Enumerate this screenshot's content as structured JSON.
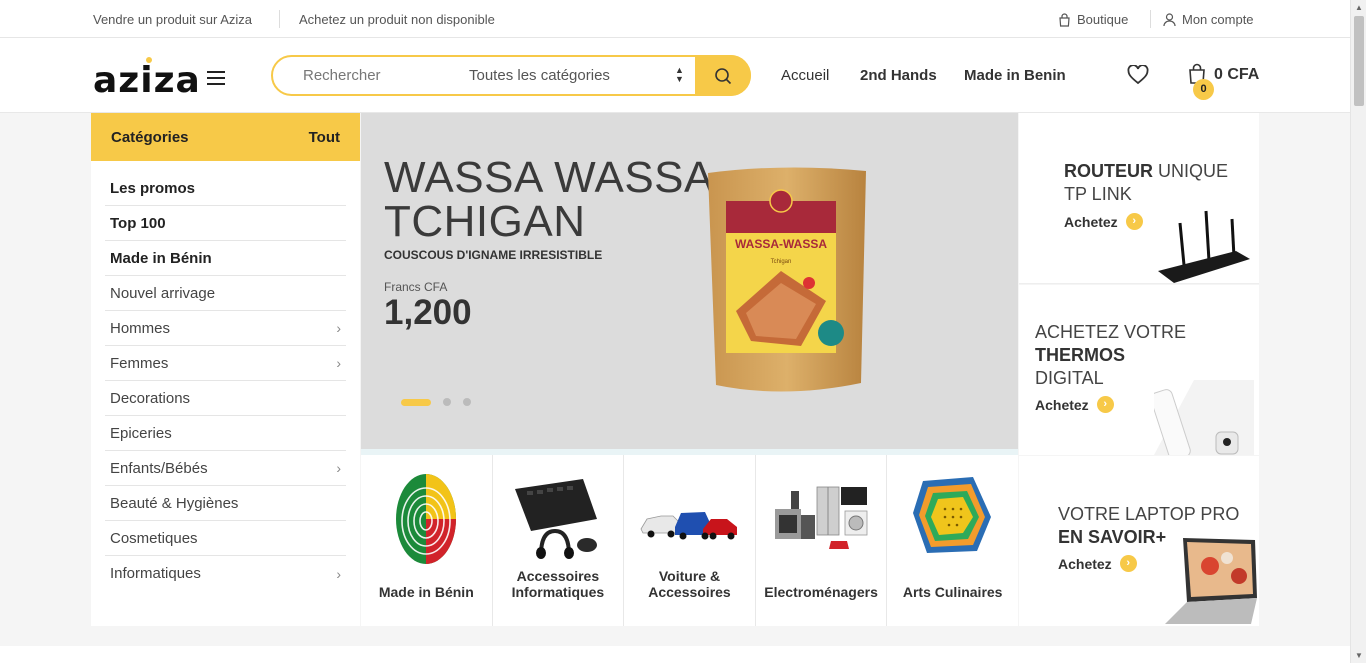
{
  "topbar": {
    "sell_link": "Vendre un produit sur Aziza",
    "request_link": "Achetez un produit non disponible",
    "shop_link": "Boutique",
    "account_link": "Mon compte"
  },
  "header": {
    "logo": "aziza",
    "search_placeholder": "Rechercher",
    "category_select": "Toutes les catégories",
    "nav": [
      "Accueil",
      "2nd Hands",
      "Made in Benin"
    ],
    "cart_count": "0",
    "cart_total": "0 CFA"
  },
  "sidebar": {
    "title": "Catégories",
    "all_link": "Tout",
    "items": [
      {
        "label": "Les promos",
        "bold": true,
        "chevron": false
      },
      {
        "label": "Top 100",
        "bold": true,
        "chevron": false
      },
      {
        "label": "Made in Bénin",
        "bold": true,
        "chevron": false
      },
      {
        "label": "Nouvel arrivage",
        "bold": false,
        "chevron": false
      },
      {
        "label": "Hommes",
        "bold": false,
        "chevron": true
      },
      {
        "label": "Femmes",
        "bold": false,
        "chevron": true
      },
      {
        "label": "Decorations",
        "bold": false,
        "chevron": false
      },
      {
        "label": "Epiceries",
        "bold": false,
        "chevron": false
      },
      {
        "label": "Enfants/Bébés",
        "bold": false,
        "chevron": true
      },
      {
        "label": "Beauté & Hygiènes",
        "bold": false,
        "chevron": false
      },
      {
        "label": "Cosmetiques",
        "bold": false,
        "chevron": false
      },
      {
        "label": "Informatiques",
        "bold": false,
        "chevron": true
      }
    ]
  },
  "banner": {
    "title_line1": "WASSA WASSA",
    "title_line2": "TCHIGAN",
    "subtitle": "COUSCOUS D'IGNAME IRRESISTIBLE",
    "currency": "Francs CFA",
    "price": "1,200",
    "bag_brand": "WASSA-WASSA",
    "bag_sub": "Tchigan",
    "slides": 3,
    "active_slide": 1
  },
  "tiles": [
    {
      "label": "Made in Bénin",
      "icon": "fingerprint-benin-flag"
    },
    {
      "label": "Accessoires Informatiques",
      "icon": "keyboard-mouse-headphones"
    },
    {
      "label": "Voiture & Accessoires",
      "icon": "cars"
    },
    {
      "label": "Electroménagers",
      "icon": "appliances"
    },
    {
      "label": "Arts Culinaires",
      "icon": "colander-set"
    }
  ],
  "promos": [
    {
      "bold": "ROUTEUR",
      "text": " UNIQUE TP LINK",
      "cta": "Achetez",
      "icon": "router"
    },
    {
      "pre": "ACHETEZ VOTRE",
      "bold": "THERMOS",
      "post": "DIGITAL",
      "cta": "Achetez",
      "icon": "thermos"
    },
    {
      "pre": "VOTRE LAPTOP PRO",
      "bold": "EN SAVOIR+",
      "cta": "Achetez",
      "icon": "laptop"
    }
  ],
  "colors": {
    "accent": "#f7c948",
    "text": "#333333"
  }
}
